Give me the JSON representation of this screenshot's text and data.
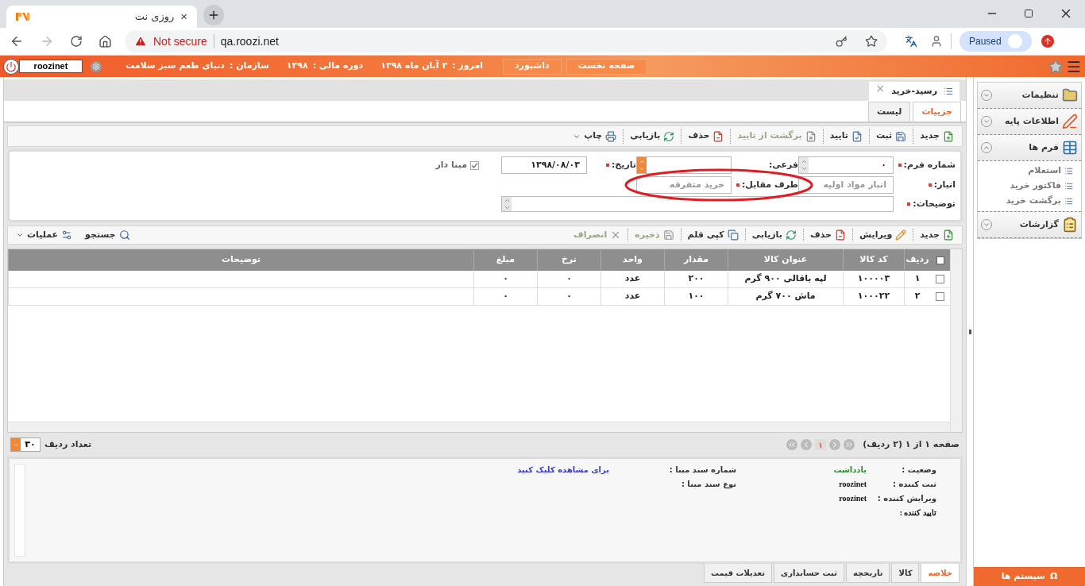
{
  "browser": {
    "tab_title": "روزی نت",
    "tab_close": "×",
    "security_label": "Not secure",
    "url": "qa.roozi.net",
    "profile_status": "Paused"
  },
  "header": {
    "nav_buttons": [
      "صفحه نخست",
      "داشبورد"
    ],
    "info": [
      {
        "label": "امروز :",
        "value": "۳ آبان ماه ۱۳۹۸"
      },
      {
        "label": "دوره مالی :",
        "value": "۱۳۹۸"
      },
      {
        "label": "سازمان :",
        "value": "دنیای طعم سبز سلامت"
      }
    ],
    "user": "roozinet"
  },
  "document_tab": {
    "title": "رسید-خرید",
    "close": "×"
  },
  "tabs": [
    {
      "label": "جزییات",
      "selected": true
    },
    {
      "label": "لیست",
      "selected": false
    }
  ],
  "toolbar": [
    {
      "kind": "new",
      "label": "جدید",
      "disabled": false,
      "dropdown": false
    },
    {
      "kind": "save",
      "label": "ثبت",
      "disabled": false,
      "dropdown": false
    },
    {
      "kind": "approve",
      "label": "تایید",
      "disabled": false,
      "dropdown": false
    },
    {
      "kind": "unapprove",
      "label": "برگشت از تایید",
      "disabled": true,
      "dropdown": false
    },
    {
      "kind": "delete",
      "label": "حذف",
      "disabled": false,
      "dropdown": false
    },
    {
      "kind": "restore",
      "label": "بازیابی",
      "disabled": false,
      "dropdown": false
    },
    {
      "kind": "print",
      "label": "چاپ",
      "disabled": false,
      "dropdown": true
    }
  ],
  "form": {
    "rows": [
      [
        {
          "kind": "number",
          "label": "شماره فرم:",
          "required": true,
          "value": "۰",
          "disabled": false
        },
        {
          "kind": "combo",
          "label": "فرعی:",
          "required": false,
          "disabled": false
        },
        {
          "kind": "text",
          "label": "تاریخ:",
          "required": true,
          "value": "۱۳۹۸/۰۸/۰۳",
          "disabled": false
        },
        {
          "kind": "checkbox",
          "label": "مبنا دار",
          "checked": true
        }
      ],
      [
        {
          "kind": "text",
          "label": "انبار:",
          "required": true,
          "value": "انبار مواد اولیه",
          "disabled": true
        },
        {
          "kind": "text",
          "label": "طرف مقابل:",
          "required": true,
          "value": "خرید متفرقه",
          "disabled": true,
          "highlighted": true
        }
      ],
      [
        {
          "kind": "textarea",
          "label": "توضیحات:",
          "required": true,
          "disabled": false
        }
      ]
    ]
  },
  "grid_toolbar": {
    "actions": [
      {
        "kind": "new",
        "label": "جدید",
        "disabled": false,
        "dropdown": false
      },
      {
        "kind": "edit",
        "label": "ویرایش",
        "disabled": false,
        "dropdown": false
      },
      {
        "kind": "delete",
        "label": "حذف",
        "disabled": false,
        "dropdown": false
      },
      {
        "kind": "restore",
        "label": "بازیابی",
        "disabled": false,
        "dropdown": false
      },
      {
        "kind": "copy",
        "label": "کپی قلم",
        "disabled": false,
        "dropdown": false
      },
      {
        "kind": "store",
        "label": "ذخیره",
        "disabled": true,
        "dropdown": false
      },
      {
        "kind": "cancel",
        "label": "انصراف",
        "disabled": true,
        "dropdown": false
      }
    ],
    "tools": [
      {
        "kind": "search",
        "label": "جستجو",
        "disabled": false,
        "dropdown": false
      },
      {
        "kind": "operations",
        "label": "عملیات",
        "disabled": false,
        "dropdown": true
      }
    ]
  },
  "table": {
    "all_checked": false,
    "columns": [
      "ردیف",
      "کد کالا",
      "عنوان کالا",
      "مقدار",
      "واحد",
      "نرخ",
      "مبلغ",
      "توضیحات"
    ],
    "rows": [
      {
        "checked": false,
        "cells": [
          "۱",
          "۱۰۰۰۰۳",
          "لپه باقالی ۹۰۰ گرم",
          "۲۰۰",
          "عدد",
          "۰",
          "۰"
        ]
      },
      {
        "checked": false,
        "cells": [
          "۲",
          "۱۰۰۰۲۲",
          "ماش ۷۰۰ گرم",
          "۱۰۰",
          "عدد",
          "۰",
          "۰"
        ]
      }
    ]
  },
  "pagination": {
    "summary": "صفحه ۱ از ۱ (۲ ردیف)",
    "current_page": "۱",
    "page_size": "۳۰",
    "page_size_label": "تعداد ردیف"
  },
  "details": {
    "fields": [
      {
        "kind": "status",
        "label": "وضعیت :",
        "value": "یادداشت"
      },
      {
        "kind": "user",
        "label": "ثبت کننده :",
        "value": "roozinet"
      },
      {
        "kind": "user",
        "label": "ویرایش کننده :",
        "value": "roozinet"
      },
      {
        "kind": "user",
        "label": "تایید کننده :"
      }
    ],
    "source_fields": [
      {
        "label": "شماره سند مبنا :",
        "link": "برای مشاهده کلیک کنید"
      },
      {
        "label": "نوع سند مبنا :"
      }
    ]
  },
  "bottom_tabs": [
    {
      "label": "خلاصه",
      "selected": true
    },
    {
      "label": "کالا",
      "selected": false
    },
    {
      "label": "تاریخچه",
      "selected": false
    },
    {
      "label": "ثبت حسابداری",
      "selected": false
    },
    {
      "label": "تعدیلات قیمت",
      "selected": false
    }
  ],
  "sidebar": {
    "sections": [
      {
        "kind": "settings",
        "label": "تنظیمات",
        "expanded": false
      },
      {
        "kind": "basic",
        "label": "اطلاعات پایه",
        "expanded": false
      },
      {
        "kind": "forms",
        "label": "فرم ها",
        "expanded": true,
        "children": [
          {
            "label": "استعلام"
          },
          {
            "label": "فاکتور خرید"
          },
          {
            "label": "برگشت خرید"
          }
        ]
      },
      {
        "kind": "reports",
        "label": "گزارشات",
        "expanded": false
      }
    ],
    "systems_button": "سیستم ها",
    "systems_symbol": "Ω"
  }
}
